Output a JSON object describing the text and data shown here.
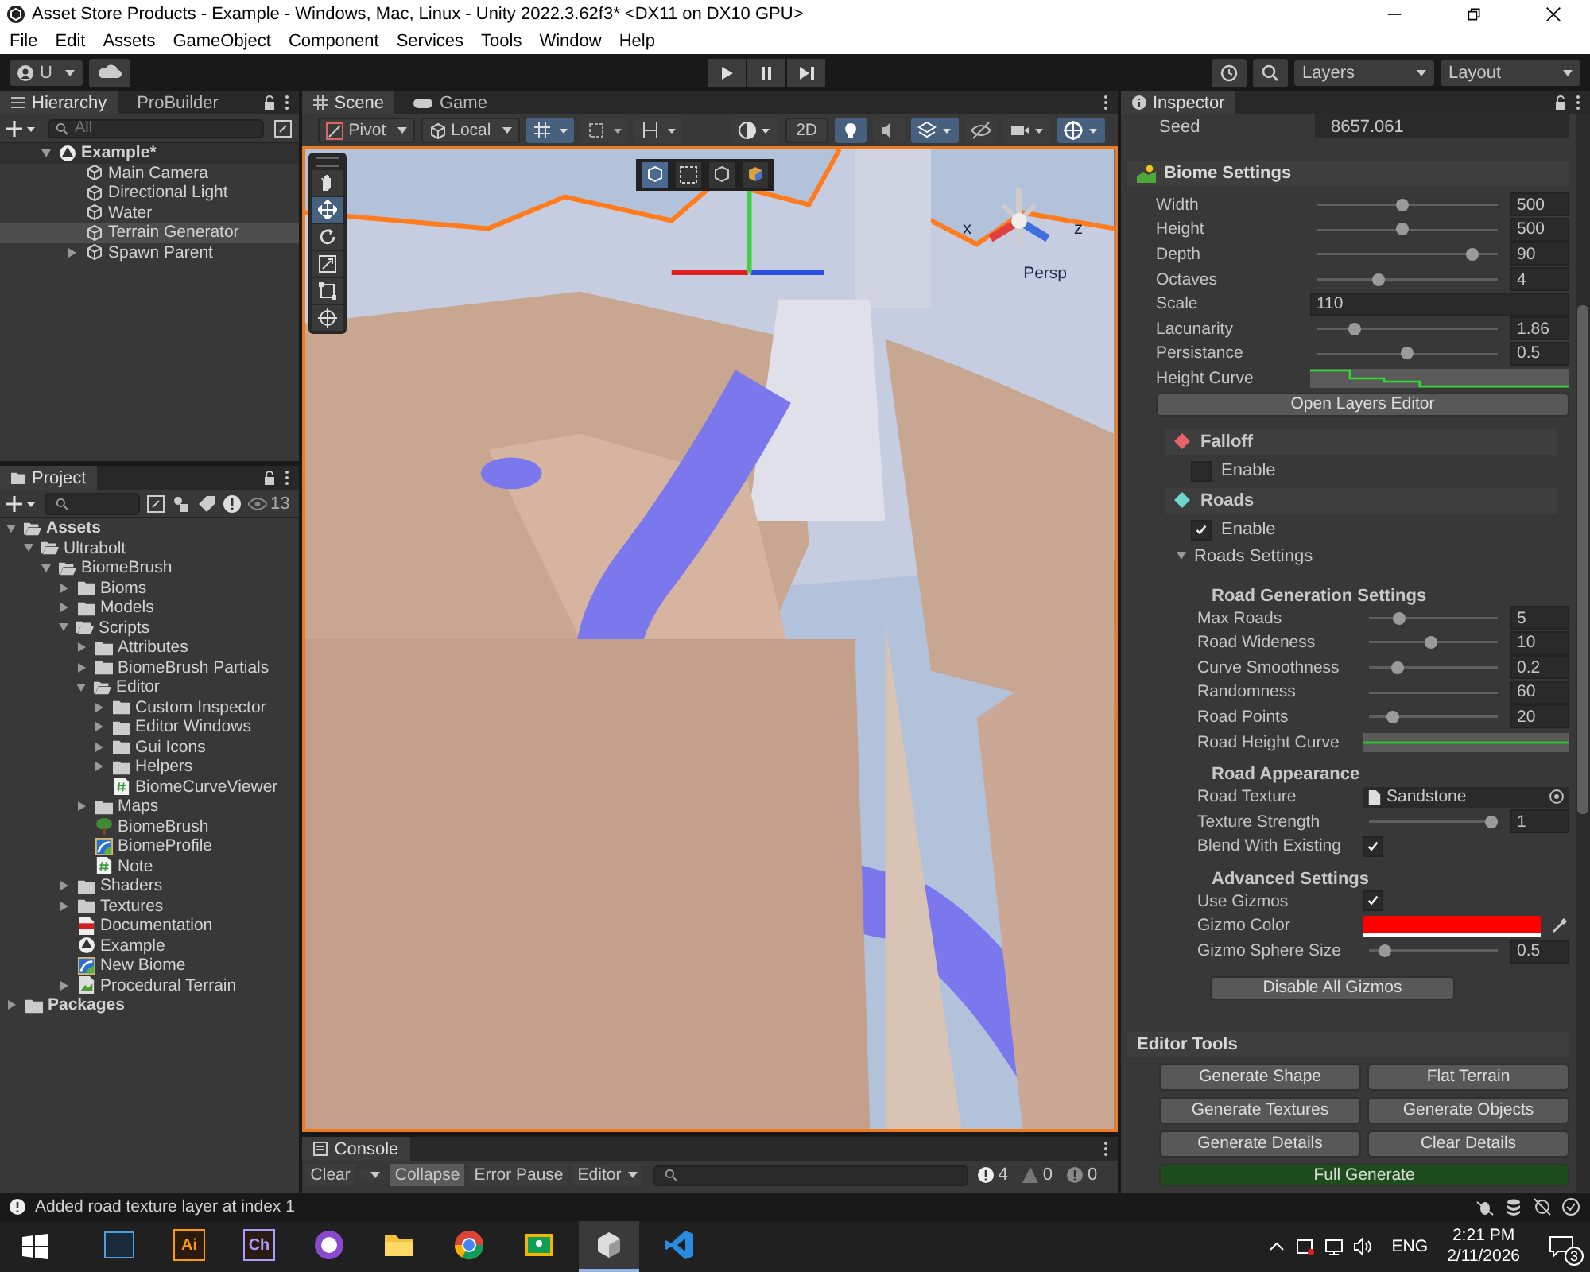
{
  "window": {
    "title": "Asset Store Products - Example - Windows, Mac, Linux - Unity 2022.3.62f3* <DX11 on DX10 GPU>"
  },
  "menu": [
    "File",
    "Edit",
    "Assets",
    "GameObject",
    "Component",
    "Services",
    "Tools",
    "Window",
    "Help"
  ],
  "toolbar": {
    "account": "U",
    "layers": "Layers",
    "layout": "Layout"
  },
  "hierarchy": {
    "tabs": [
      {
        "label": "Hierarchy",
        "selected": true
      },
      {
        "label": "ProBuilder",
        "selected": false
      }
    ],
    "search": {
      "placeholder": "All"
    },
    "tree": [
      {
        "label": "Example*",
        "kind": "scene",
        "expanded": true,
        "selected": false,
        "children": [
          {
            "label": "Main Camera",
            "kind": "object",
            "selected": false
          },
          {
            "label": "Directional Light",
            "kind": "object",
            "selected": false
          },
          {
            "label": "Water",
            "kind": "object",
            "selected": false
          },
          {
            "label": "Terrain Generator",
            "kind": "object",
            "selected": true
          },
          {
            "label": "Spawn Parent",
            "kind": "object",
            "selected": false,
            "expanded": false
          }
        ]
      }
    ]
  },
  "project": {
    "tab": "Project",
    "hidden_count": "13",
    "tree": [
      {
        "label": "Assets",
        "kind": "folder",
        "expanded": true,
        "children": [
          {
            "label": "Ultrabolt",
            "kind": "folder",
            "expanded": true,
            "children": [
              {
                "label": "BiomeBrush",
                "kind": "folder",
                "expanded": true,
                "children": [
                  {
                    "label": "Bioms",
                    "kind": "folder",
                    "expanded": false
                  },
                  {
                    "label": "Models",
                    "kind": "folder",
                    "expanded": false
                  },
                  {
                    "label": "Scripts",
                    "kind": "folder",
                    "expanded": true,
                    "children": [
                      {
                        "label": "Attributes",
                        "kind": "folder",
                        "expanded": false
                      },
                      {
                        "label": "BiomeBrush Partials",
                        "kind": "folder",
                        "expanded": false
                      },
                      {
                        "label": "Editor",
                        "kind": "folder",
                        "expanded": true,
                        "children": [
                          {
                            "label": "Custom Inspector",
                            "kind": "folder",
                            "expanded": false
                          },
                          {
                            "label": "Editor Windows",
                            "kind": "folder",
                            "expanded": false
                          },
                          {
                            "label": "Gui Icons",
                            "kind": "folder",
                            "expanded": false
                          },
                          {
                            "label": "Helpers",
                            "kind": "folder",
                            "expanded": false
                          },
                          {
                            "label": "BiomeCurveViewer",
                            "kind": "script"
                          }
                        ]
                      },
                      {
                        "label": "Maps",
                        "kind": "folder",
                        "expanded": false
                      },
                      {
                        "label": "BiomeBrush",
                        "kind": "tree"
                      },
                      {
                        "label": "BiomeProfile",
                        "kind": "profile"
                      },
                      {
                        "label": "Note",
                        "kind": "script"
                      }
                    ]
                  },
                  {
                    "label": "Shaders",
                    "kind": "folder",
                    "expanded": false
                  },
                  {
                    "label": "Textures",
                    "kind": "folder",
                    "expanded": false
                  },
                  {
                    "label": "Documentation",
                    "kind": "pdf"
                  },
                  {
                    "label": "Example",
                    "kind": "scene"
                  },
                  {
                    "label": "New Biome",
                    "kind": "profile"
                  },
                  {
                    "label": "Procedural Terrain",
                    "kind": "prefab",
                    "expanded": false
                  }
                ]
              }
            ]
          }
        ]
      },
      {
        "label": "Packages",
        "kind": "folder",
        "expanded": false
      }
    ]
  },
  "scene_view": {
    "tabs": [
      {
        "label": "Scene",
        "selected": true
      },
      {
        "label": "Game",
        "selected": false
      }
    ],
    "pivot": "Pivot",
    "space": "Local",
    "mode_2d": "2D",
    "camera_label": "Persp",
    "axes": [
      "x",
      "z"
    ],
    "tools": [
      {
        "kind": "hand",
        "selected": false
      },
      {
        "kind": "move",
        "selected": true
      },
      {
        "kind": "rotate",
        "selected": false
      },
      {
        "kind": "scale",
        "selected": false
      },
      {
        "kind": "rect",
        "selected": false
      },
      {
        "kind": "transform",
        "selected": false
      }
    ]
  },
  "console": {
    "tab": "Console",
    "buttons": [
      {
        "label": "Clear",
        "selected": false
      },
      {
        "label": "Collapse",
        "selected": true
      },
      {
        "label": "Error Pause",
        "selected": false
      }
    ],
    "editor": "Editor",
    "counts": {
      "log": "4",
      "warn": "0",
      "error": "0"
    }
  },
  "inspector": {
    "tab": "Inspector",
    "seed": {
      "label": "Seed",
      "value": "8657.061"
    },
    "biome_settings": {
      "title": "Biome Settings",
      "rows": [
        {
          "kind": "slider",
          "label": "Width",
          "level": 0.47,
          "value": "500"
        },
        {
          "kind": "slider",
          "label": "Height",
          "level": 0.47,
          "value": "500"
        },
        {
          "kind": "slider",
          "label": "Depth",
          "level": 0.86,
          "value": "90"
        },
        {
          "kind": "slider",
          "label": "Octaves",
          "level": 0.34,
          "value": "4"
        },
        {
          "kind": "number",
          "label": "Scale",
          "value": "110"
        },
        {
          "kind": "slider",
          "label": "Lacunarity",
          "level": 0.21,
          "value": "1.86"
        },
        {
          "kind": "slider",
          "label": "Persistance",
          "level": 0.5,
          "value": "0.5"
        },
        {
          "kind": "step-curve",
          "label": "Height Curve"
        }
      ],
      "button": "Open Layers Editor",
      "modules": [
        {
          "title": "Falloff",
          "color": "#e8646a",
          "enable": {
            "label": "Enable",
            "checked": false
          }
        },
        {
          "title": "Roads",
          "color": "#6fd8cc",
          "enable": {
            "label": "Enable",
            "checked": true
          },
          "foldout": {
            "label": "Roads Settings",
            "expanded": true,
            "groups": [
              {
                "title": "Road Generation Settings",
                "rows": [
                  {
                    "kind": "slider",
                    "label": "Max Roads",
                    "level": 0.23,
                    "value": "5"
                  },
                  {
                    "kind": "slider",
                    "label": "Road Wideness",
                    "level": 0.48,
                    "value": "10"
                  },
                  {
                    "kind": "slider",
                    "label": "Curve Smoothness",
                    "level": 0.22,
                    "value": "0.2"
                  },
                  {
                    "kind": "bare-slider",
                    "label": "Randomness",
                    "value": "60"
                  },
                  {
                    "kind": "slider",
                    "label": "Road Points",
                    "level": 0.19,
                    "value": "20"
                  },
                  {
                    "kind": "flat-curve",
                    "label": "Road Height Curve"
                  }
                ]
              },
              {
                "title": "Road Appearance",
                "rows": [
                  {
                    "kind": "object",
                    "label": "Road Texture",
                    "value": "Sandstone"
                  },
                  {
                    "kind": "slider",
                    "label": "Texture Strength",
                    "level": 0.95,
                    "value": "1"
                  },
                  {
                    "kind": "checkbox",
                    "label": "Blend With Existing",
                    "checked": true
                  }
                ]
              },
              {
                "title": "Advanced Settings",
                "rows": [
                  {
                    "kind": "checkbox",
                    "label": "Use Gizmos",
                    "checked": true
                  },
                  {
                    "kind": "color",
                    "label": "Gizmo Color",
                    "color": "#ff0000"
                  },
                  {
                    "kind": "slider",
                    "label": "Gizmo Sphere Size",
                    "level": 0.12,
                    "value": "0.5"
                  }
                ]
              }
            ]
          }
        }
      ]
    },
    "gizmo_button": "Disable All Gizmos",
    "editor_tools": {
      "title": "Editor Tools",
      "button_rows": [
        [
          "Generate Shape",
          "Flat Terrain"
        ],
        [
          "Generate Textures",
          "Generate Objects"
        ],
        [
          "Generate Details",
          "Clear Details"
        ],
        [
          "Full Generate"
        ]
      ]
    }
  },
  "status_bar": {
    "message": "Added road texture layer at index 1"
  },
  "taskbar": {
    "apps": [
      {
        "kind": "terminal",
        "selected": false
      },
      {
        "kind": "letters",
        "label": "Ai",
        "color": "#ff9a00",
        "selected": false
      },
      {
        "kind": "letters",
        "label": "Ch",
        "color": "#a99cff",
        "selected": false
      },
      {
        "kind": "octocat",
        "selected": false
      },
      {
        "kind": "folder",
        "selected": false
      },
      {
        "kind": "browser",
        "selected": false
      },
      {
        "kind": "board",
        "selected": false
      },
      {
        "kind": "cube",
        "selected": true
      },
      {
        "kind": "code",
        "selected": false
      }
    ],
    "language": "ENG",
    "time": "2:21 PM",
    "date": "2/11/2026",
    "notifications": "3"
  }
}
